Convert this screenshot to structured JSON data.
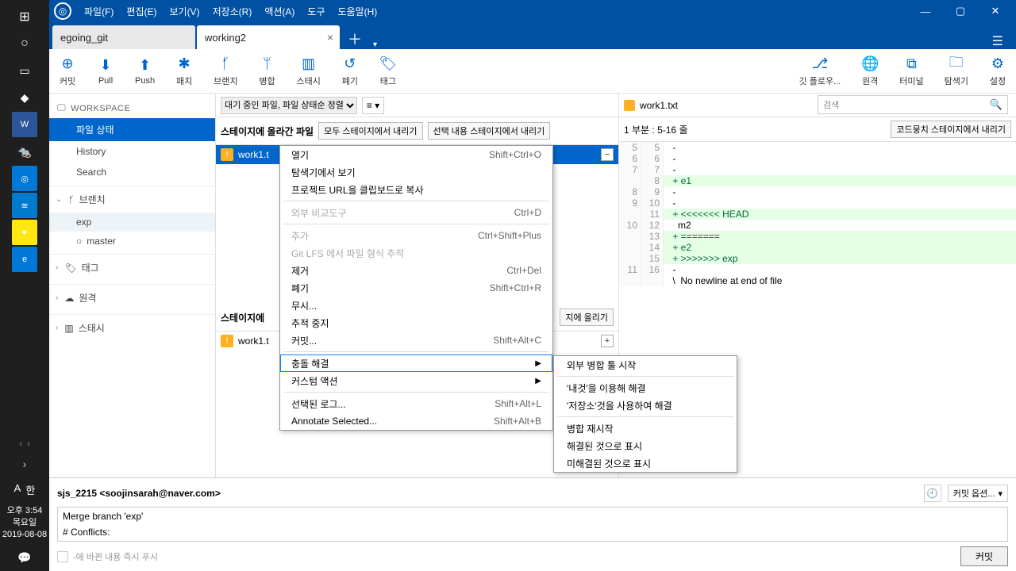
{
  "taskbar": {
    "clock_time": "오후 3:54",
    "clock_day": "목요일",
    "clock_date": "2019-08-08",
    "lang_a": "A",
    "lang_ime": "한"
  },
  "menu": {
    "file": "파일(F)",
    "edit": "편집(E)",
    "view": "보기(V)",
    "repo": "저장소(R)",
    "action": "액션(A)",
    "tool": "도구",
    "help": "도움말(H)"
  },
  "tabs": {
    "t1": "egoing_git",
    "t2": "working2"
  },
  "tools": {
    "commit": "커밋",
    "pull": "Pull",
    "push": "Push",
    "patch": "패치",
    "branch": "브랜치",
    "merge": "병합",
    "stash": "스태시",
    "discard": "폐기",
    "tag": "태그",
    "gitflow": "깃 플로우...",
    "remote": "원격",
    "terminal": "터미널",
    "explorer": "탐색기",
    "settings": "설정"
  },
  "sidebar": {
    "workspace": "WORKSPACE",
    "file_status": "파일 상태",
    "history": "History",
    "search": "Search",
    "branch": "브랜치",
    "branch_exp": "exp",
    "branch_master": "master",
    "tag": "태그",
    "remote": "원격",
    "stash": "스태시"
  },
  "filter": {
    "sort": "대기 중인 파일, 파일 상태순 정렬",
    "search_placeholder": "검색"
  },
  "staged": {
    "header": "스테이지에 올라간 파일",
    "unstage_all": "모두 스테이지에서 내리기",
    "unstage_sel": "선택 내용 스테이지에서 내리기",
    "file": "work1.t"
  },
  "unstaged": {
    "header": "스테이지에",
    "stage_sel": "지에 올리기",
    "file": "work1.t"
  },
  "diff": {
    "filename": "work1.txt",
    "hunk": "1 부분 : 5-16 줄",
    "unstage_hunk": "코드뭉치 스테이지에서 내리기",
    "lines": [
      {
        "l": "5",
        "r": "5",
        "t": " -",
        "cls": ""
      },
      {
        "l": "6",
        "r": "6",
        "t": " -",
        "cls": ""
      },
      {
        "l": "7",
        "r": "7",
        "t": " -",
        "cls": ""
      },
      {
        "l": "",
        "r": "8",
        "t": " + e1",
        "cls": "add"
      },
      {
        "l": "8",
        "r": "9",
        "t": " -",
        "cls": ""
      },
      {
        "l": "9",
        "r": "10",
        "t": " -",
        "cls": ""
      },
      {
        "l": "",
        "r": "11",
        "t": " + <<<<<<< HEAD",
        "cls": "add"
      },
      {
        "l": "10",
        "r": "12",
        "t": "   m2",
        "cls": ""
      },
      {
        "l": "",
        "r": "13",
        "t": " + =======",
        "cls": "add"
      },
      {
        "l": "",
        "r": "14",
        "t": " + e2",
        "cls": "add"
      },
      {
        "l": "",
        "r": "15",
        "t": " + >>>>>>> exp",
        "cls": "add"
      },
      {
        "l": "11",
        "r": "16",
        "t": " -",
        "cls": ""
      },
      {
        "l": "",
        "r": "",
        "t": " \\  No newline at end of file",
        "cls": ""
      }
    ]
  },
  "commit": {
    "author": "sjs_2215  <soojinsarah@naver.com>",
    "msg_l1": "Merge branch 'exp'",
    "msg_l2": "# Conflicts:",
    "immediate": "-에 바뀐 내용 즉시 푸시",
    "options": "커밋 옵션...",
    "button": "커밋"
  },
  "ctx": {
    "open": "열기",
    "open_sc": "Shift+Ctrl+O",
    "reveal": "탐색기에서 보기",
    "copyurl": "프로젝트 URL을 클립보드로 복사",
    "diffext": "외부 비교도구",
    "diffext_sc": "Ctrl+D",
    "add": "추가",
    "add_sc": "Ctrl+Shift+Plus",
    "lfs": "Git LFS 에서 파일 형식 추적",
    "remove": "제거",
    "remove_sc": "Ctrl+Del",
    "discard": "폐기",
    "discard_sc": "Shift+Ctrl+R",
    "ignore": "무시...",
    "untrack": "추적 중지",
    "commitm": "커밋...",
    "commitm_sc": "Shift+Alt+C",
    "resolve": "충돌 해결",
    "custom": "커스텀 액션",
    "sellog": "선택된 로그...",
    "sellog_sc": "Shift+Alt+L",
    "annotate": "Annotate Selected...",
    "annotate_sc": "Shift+Alt+B"
  },
  "ctx_sub": {
    "ext_merge": "외부 병합 툴 시작",
    "use_mine": "'내것'을 이용해 해결",
    "use_theirs": "'저장소'것을 사용하여 해결",
    "restart": "병합 재시작",
    "mark_resolved": "해결된 것으로 표시",
    "mark_unresolved": "미해결된 것으로 표시"
  }
}
